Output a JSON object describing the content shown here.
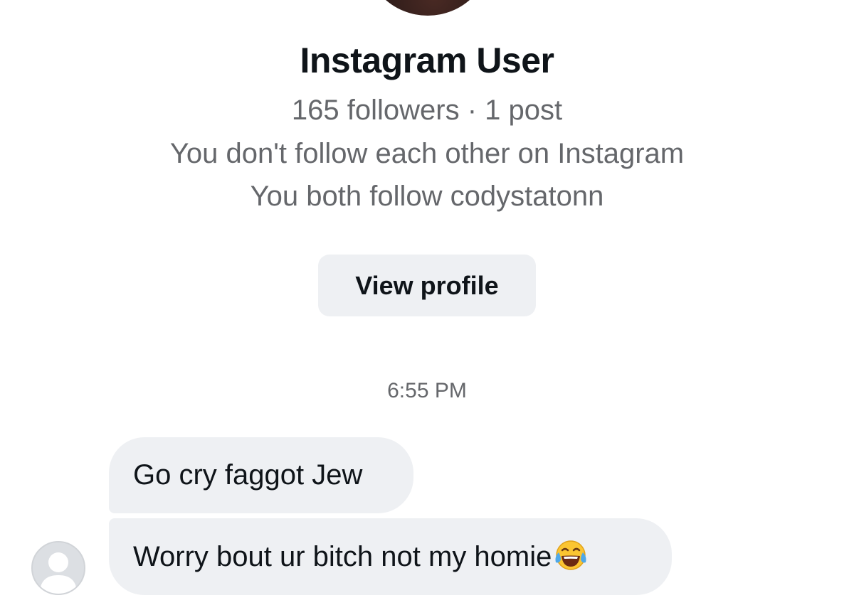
{
  "profile": {
    "name": "Instagram User",
    "followers_line": "165 followers · 1 post",
    "relationship_line": "You don't follow each other on Instagram",
    "mutual_line": "You both follow codystatonn",
    "view_profile_label": "View profile"
  },
  "conversation": {
    "timestamp": "6:55 PM",
    "messages": [
      {
        "text": "Go cry faggot Jew"
      },
      {
        "text": "Worry bout ur bitch not my homie",
        "emoji": "face-with-tears-of-joy"
      }
    ]
  },
  "colors": {
    "bubble_bg": "#eef0f3",
    "secondary_text": "#65676b",
    "primary_text": "#0f1419"
  }
}
